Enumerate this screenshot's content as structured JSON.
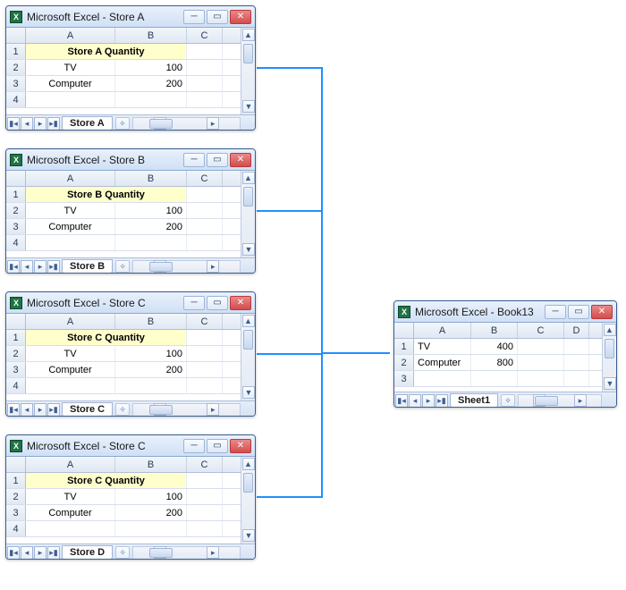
{
  "source_windows": [
    {
      "title": "Microsoft Excel - Store A",
      "header_text": "Store A Quantity",
      "tab_label": "Store A",
      "rows": [
        {
          "item": "TV",
          "qty": "100"
        },
        {
          "item": "Computer",
          "qty": "200"
        }
      ]
    },
    {
      "title": "Microsoft Excel - Store B",
      "header_text": "Store B Quantity",
      "tab_label": "Store B",
      "rows": [
        {
          "item": "TV",
          "qty": "100"
        },
        {
          "item": "Computer",
          "qty": "200"
        }
      ]
    },
    {
      "title": "Microsoft Excel - Store C",
      "header_text": "Store C Quantity",
      "tab_label": "Store C",
      "rows": [
        {
          "item": "TV",
          "qty": "100"
        },
        {
          "item": "Computer",
          "qty": "200"
        }
      ]
    },
    {
      "title": "Microsoft Excel - Store C",
      "header_text": "Store C Quantity",
      "tab_label": "Store D",
      "rows": [
        {
          "item": "TV",
          "qty": "100"
        },
        {
          "item": "Computer",
          "qty": "200"
        }
      ]
    }
  ],
  "result_window": {
    "title": "Microsoft Excel - Book13",
    "tab_label": "Sheet1",
    "rows": [
      {
        "item": "TV",
        "qty": "400"
      },
      {
        "item": "Computer",
        "qty": "800"
      }
    ]
  },
  "columns": {
    "A": "A",
    "B": "B",
    "C": "C",
    "D": "D"
  }
}
